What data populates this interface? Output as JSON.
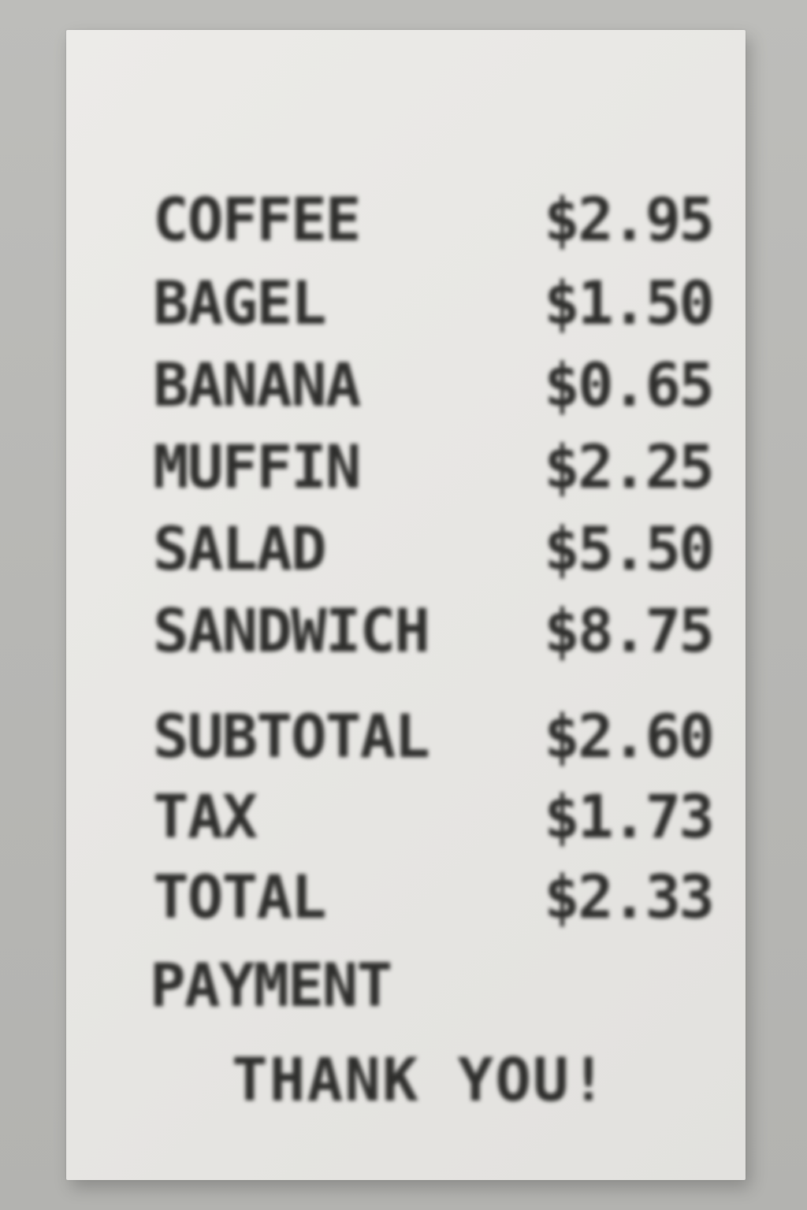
{
  "receipt": {
    "items": [
      {
        "name": "COFFEE",
        "price": "$2.95"
      },
      {
        "name": "BAGEL",
        "price": "$1.50"
      },
      {
        "name": "BANANA",
        "price": "$0.65"
      },
      {
        "name": "MUFFIN",
        "price": "$2.25"
      },
      {
        "name": "SALAD",
        "price": "$5.50"
      },
      {
        "name": "SANDWICH",
        "price": "$8.75"
      }
    ],
    "totals": [
      {
        "name": "SUBTOTAL",
        "price": "$2.60"
      },
      {
        "name": "TAX",
        "price": "$1.73"
      },
      {
        "name": "TOTAL",
        "price": "$2.33"
      }
    ],
    "payment_label": "PAYMENT",
    "footer": "THANK YOU!"
  }
}
